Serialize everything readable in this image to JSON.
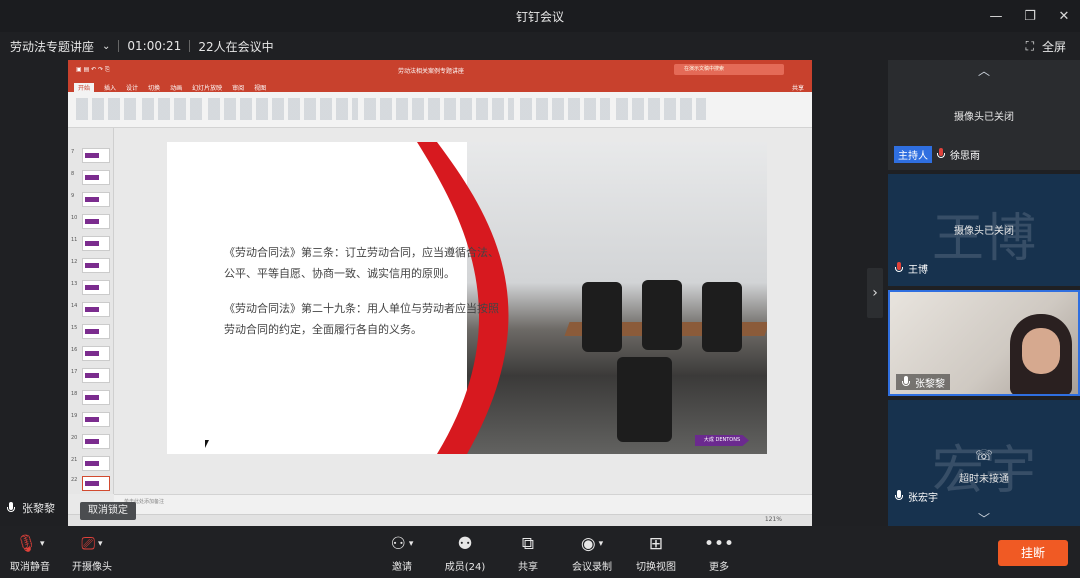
{
  "window": {
    "title": "钉钉会议"
  },
  "meeting": {
    "topic": "劳动法专题讲座",
    "duration": "01:00:21",
    "participants_text": "22人在会议中",
    "fullscreen_label": "全屏"
  },
  "presentation": {
    "doc_title": "劳动法相关案例专题讲座",
    "search_placeholder": "在演示文稿中搜索",
    "ribbon_tabs": [
      "开始",
      "插入",
      "设计",
      "切换",
      "动画",
      "幻灯片放映",
      "审阅",
      "视图"
    ],
    "share_label": "共享",
    "thumbnail_numbers": [
      "7",
      "8",
      "9",
      "10",
      "11",
      "12",
      "13",
      "14",
      "15",
      "16",
      "17",
      "18",
      "19",
      "20",
      "21",
      "22"
    ],
    "notes_placeholder": "单击此处添加备注",
    "slide": {
      "paragraphs": [
        "《劳动合同法》第三条：订立劳动合同，应当遵循合法、公平、平等自愿、协商一致、诚实信用的原则。",
        "《劳动合同法》第二十九条：用人单位与劳动者应当按照劳动合同的约定，全面履行各自的义务。"
      ],
      "logo_text": "大成 DENTONS"
    },
    "zoom": "121%"
  },
  "self": {
    "name": "张黎黎",
    "mute_tooltip": "取消锁定"
  },
  "participants": [
    {
      "name": "徐思雨",
      "status": "摄像头已关闭",
      "badge": "主持人",
      "bigname": ""
    },
    {
      "name": "王博",
      "status": "摄像头已关闭",
      "badge": "",
      "bigname": "王博"
    },
    {
      "name": "张黎黎",
      "status": "",
      "badge": "",
      "bigname": ""
    },
    {
      "name": "张宏宇",
      "status": "超时未接通",
      "badge": "",
      "bigname": "宏宇"
    }
  ],
  "toolbar": {
    "mute": "取消静音",
    "camera": "开摄像头",
    "invite": "邀请",
    "members": "成员(24)",
    "share": "共享",
    "record": "会议录制",
    "switch_view": "切换视图",
    "more": "更多",
    "hangup": "挂断"
  },
  "colors": {
    "accent": "#f05a24",
    "ppt_red": "#c8412d",
    "host_blue": "#2f6fe0",
    "tile_bg": "#17324e"
  }
}
